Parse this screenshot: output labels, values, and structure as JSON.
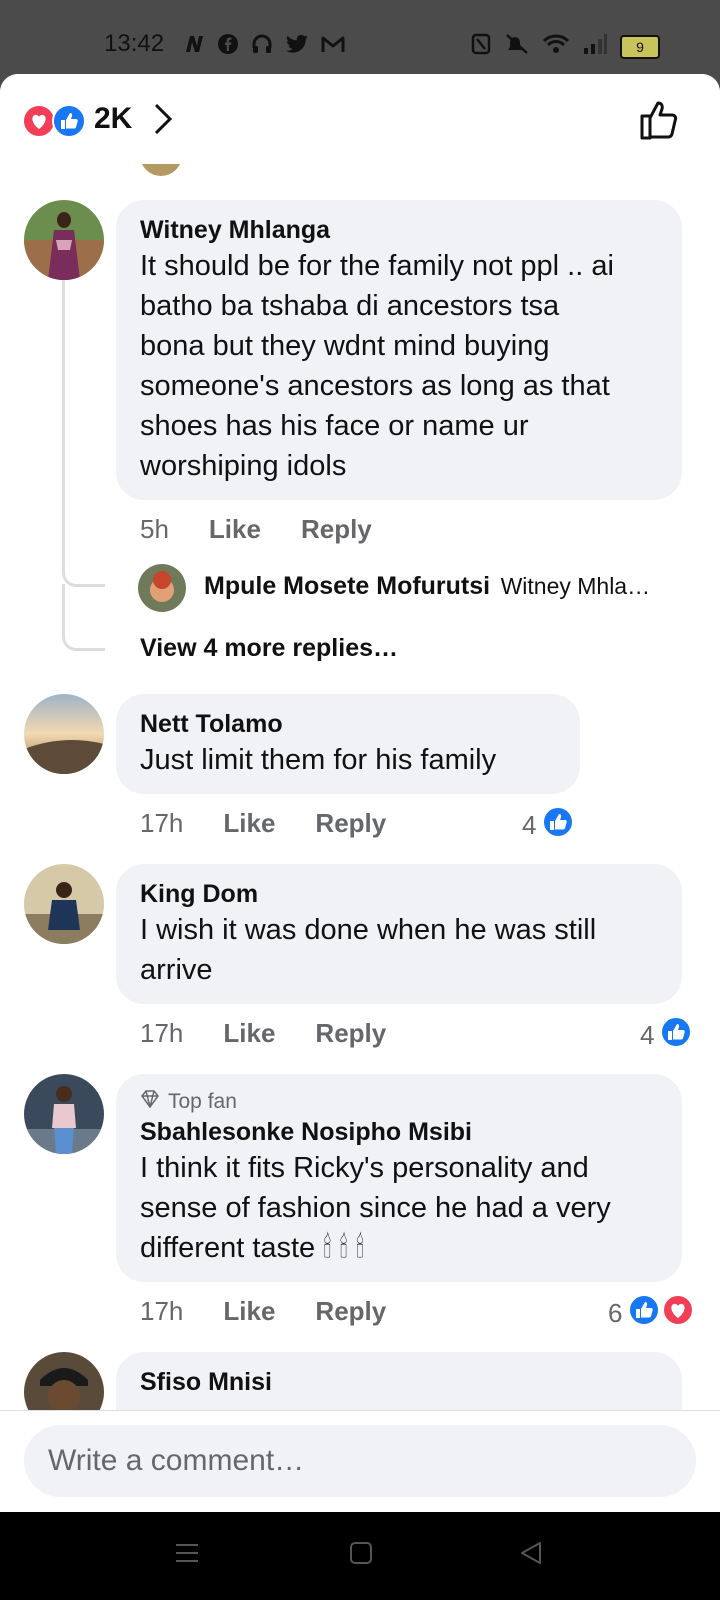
{
  "status": {
    "time": "13:42",
    "battery": "9"
  },
  "header": {
    "reaction_count": "2K"
  },
  "comments": [
    {
      "name": "Witney Mhlanga",
      "lines": [
        "It should be for the family not ppl .. ai",
        "batho ba  tshaba di  ancestors  tsa",
        "bona but they wdnt mind buying",
        "someone's  ancestors as long as that",
        "shoes has his face or name ur",
        "worshiping idols"
      ],
      "time": "5h",
      "like": "Like",
      "reply": "Reply"
    },
    {
      "name": "Nett Tolamo",
      "lines": [
        "Just limit them for his family"
      ],
      "time": "17h",
      "like": "Like",
      "reply": "Reply",
      "reaction_count": "4"
    },
    {
      "name": "King Dom",
      "lines": [
        "I wish it was done when he was still",
        "arrive"
      ],
      "time": "17h",
      "like": "Like",
      "reply": "Reply",
      "reaction_count": "4"
    },
    {
      "badge": "Top fan",
      "name": "Sbahlesonke Nosipho Msibi",
      "lines": [
        "I think it fits Ricky's personality and",
        "sense of fashion since he had a very",
        "different taste 🕯 🕯 🕯"
      ],
      "time": "17h",
      "like": "Like",
      "reply": "Reply",
      "reaction_count": "6"
    },
    {
      "name": "Sfiso Mnisi"
    }
  ],
  "reply_preview": {
    "name": "Mpule Mosete Mofurutsi",
    "text": "Witney Mhla…"
  },
  "view_more": "View 4 more replies…",
  "composer": {
    "placeholder": "Write a comment…"
  },
  "colors": {
    "like_blue": "#1877f2",
    "love_red": "#f33e58",
    "bubble": "#f0f2f5"
  }
}
